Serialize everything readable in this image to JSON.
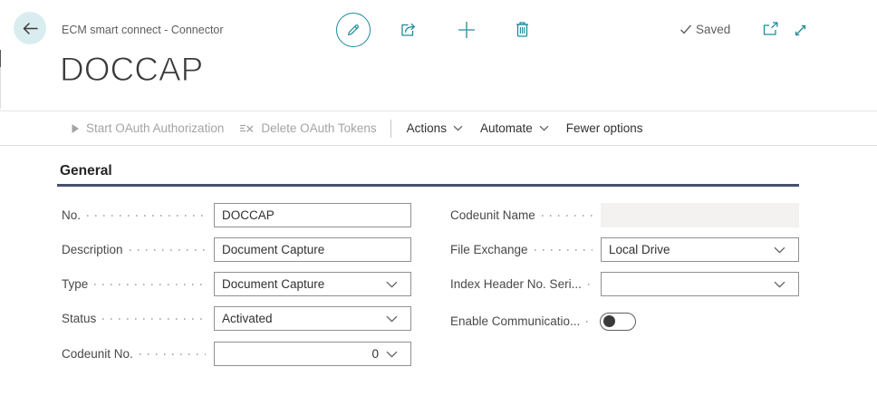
{
  "header": {
    "caption": "ECM smart connect - Connector",
    "saved_label": "Saved"
  },
  "title": "DOCCAP",
  "toolbar": {
    "start_oauth": "Start OAuth Authorization",
    "delete_tokens": "Delete OAuth Tokens",
    "actions": "Actions",
    "automate": "Automate",
    "fewer_options": "Fewer options"
  },
  "section": {
    "title": "General"
  },
  "form": {
    "left": [
      {
        "label": "No.",
        "value": "DOCCAP",
        "control": "text"
      },
      {
        "label": "Description",
        "value": "Document Capture",
        "control": "text"
      },
      {
        "label": "Type",
        "value": "Document Capture",
        "control": "select"
      },
      {
        "label": "Status",
        "value": "Activated",
        "control": "select"
      },
      {
        "label": "Codeunit No.",
        "value": "0",
        "control": "select-numeric"
      }
    ],
    "right": [
      {
        "label": "Codeunit Name",
        "value": "",
        "control": "text-disabled"
      },
      {
        "label": "File Exchange",
        "value": "Local Drive",
        "control": "select"
      },
      {
        "label": "Index Header No. Seri...",
        "value": "",
        "control": "select"
      },
      {
        "label": "Enable Communicatio...",
        "value": "off",
        "control": "toggle"
      }
    ]
  },
  "colors": {
    "accent": "#1d8a9c",
    "heading_underline": "#44546a",
    "saved_text": "#605e5c"
  }
}
